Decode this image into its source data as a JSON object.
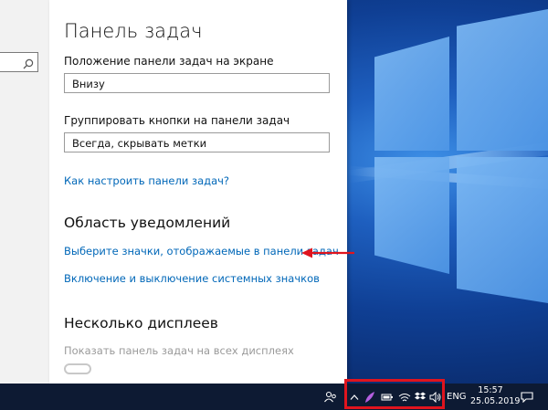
{
  "settings": {
    "title": "Панель задач",
    "position": {
      "label": "Положение панели задач на экране",
      "value": "Внизу"
    },
    "group_buttons": {
      "label": "Группировать кнопки на панели задач",
      "value": "Всегда, скрывать метки"
    },
    "help_link": "Как настроить панели задач?",
    "notification_area": {
      "heading": "Область уведомлений",
      "select_icons_link": "Выберите значки, отображаемые в панели задач",
      "system_icons_link": "Включение и выключение системных значков"
    },
    "multiple_displays": {
      "heading": "Несколько дисплеев",
      "show_on_all_label": "Показать панель задач на всех дисплеях"
    }
  },
  "taskbar": {
    "language": "ENG",
    "time": "15:57",
    "date": "25.05.2019",
    "tray_icons": [
      "people-icon",
      "chevron-up-icon",
      "feather-icon",
      "battery-icon",
      "wifi-icon",
      "dropbox-icon",
      "volume-icon"
    ],
    "notification_icon": "action-center-icon"
  },
  "colors": {
    "link": "#0067b8",
    "highlight": "#e0141e",
    "taskbar": "#0d1a33"
  }
}
